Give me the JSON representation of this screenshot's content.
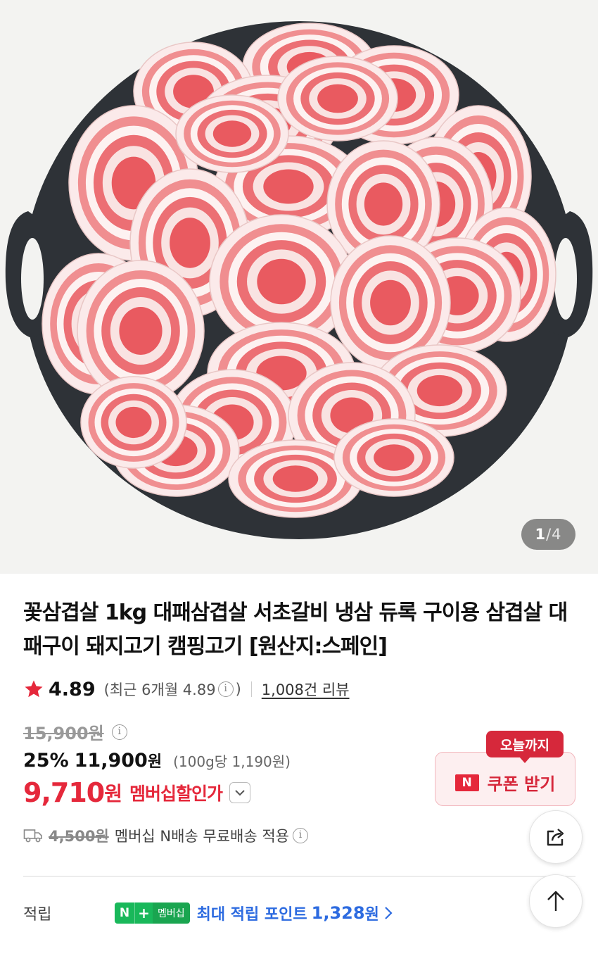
{
  "gallery": {
    "current": "1",
    "separator": "/",
    "total": "4"
  },
  "product": {
    "title": "꽃삼겹살 1kg 대패삼겹살 서초갈비 냉삼 듀록 구이용 삼겹살 대패구이 돼지고기 캠핑고기 [원산지:스페인]"
  },
  "rating": {
    "score": "4.89",
    "recent_prefix": "(최근 6개월 4.89",
    "recent_suffix": ")",
    "review_link": "1,008건 리뷰"
  },
  "price": {
    "original": "15,900원",
    "discount": "25%",
    "sale": "11,900",
    "sale_unit": "원",
    "unit_price": "(100g당 1,190원)",
    "member_price": "9,710",
    "member_unit": "원",
    "member_label": "멤버십할인가"
  },
  "coupon": {
    "badge": "오늘까지",
    "n_mark": "N",
    "label": "쿠폰 받기"
  },
  "delivery": {
    "original_fee": "4,500원",
    "text": "멤버십 N배송 무료배송 적용"
  },
  "points": {
    "label": "적립",
    "badge_n": "N",
    "badge_plus": "+",
    "badge_member": "멤버십",
    "text": "최대 적립 포인트",
    "value": "1,328",
    "unit": "원"
  },
  "icons": {
    "star": "star-icon",
    "info": "info-icon",
    "chevron_down": "chevron-down-icon",
    "truck": "truck-icon",
    "share": "share-icon",
    "arrow_up": "arrow-up-icon",
    "chevron_right": "chevron-right-icon"
  },
  "colors": {
    "accent_red": "#e5283b",
    "points_blue": "#2d6be0",
    "naver_green": "#19b85a"
  }
}
